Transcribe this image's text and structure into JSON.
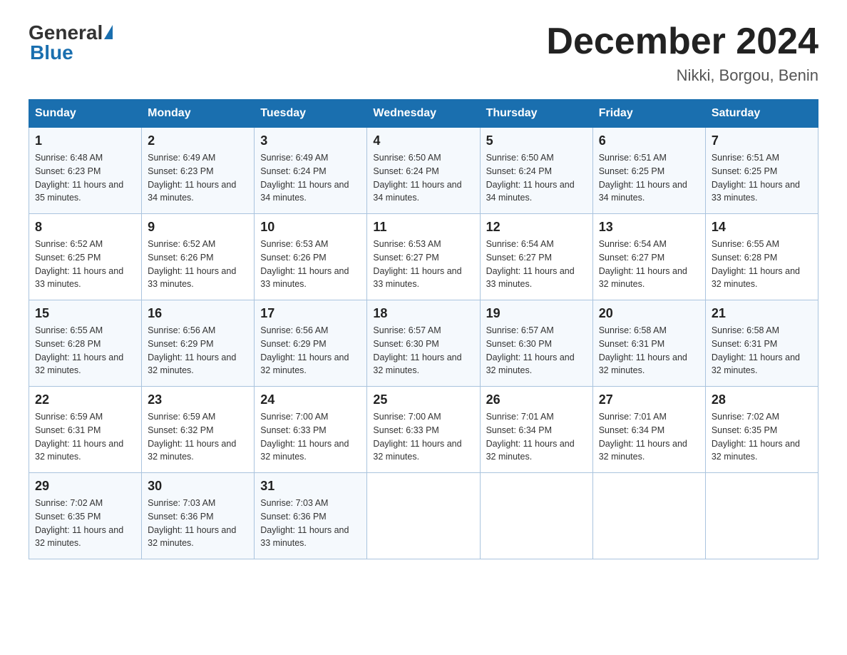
{
  "header": {
    "logo_general": "General",
    "logo_blue": "Blue",
    "month_title": "December 2024",
    "location": "Nikki, Borgou, Benin"
  },
  "weekdays": [
    "Sunday",
    "Monday",
    "Tuesday",
    "Wednesday",
    "Thursday",
    "Friday",
    "Saturday"
  ],
  "weeks": [
    [
      {
        "day": "1",
        "sunrise": "6:48 AM",
        "sunset": "6:23 PM",
        "daylight": "11 hours and 35 minutes."
      },
      {
        "day": "2",
        "sunrise": "6:49 AM",
        "sunset": "6:23 PM",
        "daylight": "11 hours and 34 minutes."
      },
      {
        "day": "3",
        "sunrise": "6:49 AM",
        "sunset": "6:24 PM",
        "daylight": "11 hours and 34 minutes."
      },
      {
        "day": "4",
        "sunrise": "6:50 AM",
        "sunset": "6:24 PM",
        "daylight": "11 hours and 34 minutes."
      },
      {
        "day": "5",
        "sunrise": "6:50 AM",
        "sunset": "6:24 PM",
        "daylight": "11 hours and 34 minutes."
      },
      {
        "day": "6",
        "sunrise": "6:51 AM",
        "sunset": "6:25 PM",
        "daylight": "11 hours and 34 minutes."
      },
      {
        "day": "7",
        "sunrise": "6:51 AM",
        "sunset": "6:25 PM",
        "daylight": "11 hours and 33 minutes."
      }
    ],
    [
      {
        "day": "8",
        "sunrise": "6:52 AM",
        "sunset": "6:25 PM",
        "daylight": "11 hours and 33 minutes."
      },
      {
        "day": "9",
        "sunrise": "6:52 AM",
        "sunset": "6:26 PM",
        "daylight": "11 hours and 33 minutes."
      },
      {
        "day": "10",
        "sunrise": "6:53 AM",
        "sunset": "6:26 PM",
        "daylight": "11 hours and 33 minutes."
      },
      {
        "day": "11",
        "sunrise": "6:53 AM",
        "sunset": "6:27 PM",
        "daylight": "11 hours and 33 minutes."
      },
      {
        "day": "12",
        "sunrise": "6:54 AM",
        "sunset": "6:27 PM",
        "daylight": "11 hours and 33 minutes."
      },
      {
        "day": "13",
        "sunrise": "6:54 AM",
        "sunset": "6:27 PM",
        "daylight": "11 hours and 32 minutes."
      },
      {
        "day": "14",
        "sunrise": "6:55 AM",
        "sunset": "6:28 PM",
        "daylight": "11 hours and 32 minutes."
      }
    ],
    [
      {
        "day": "15",
        "sunrise": "6:55 AM",
        "sunset": "6:28 PM",
        "daylight": "11 hours and 32 minutes."
      },
      {
        "day": "16",
        "sunrise": "6:56 AM",
        "sunset": "6:29 PM",
        "daylight": "11 hours and 32 minutes."
      },
      {
        "day": "17",
        "sunrise": "6:56 AM",
        "sunset": "6:29 PM",
        "daylight": "11 hours and 32 minutes."
      },
      {
        "day": "18",
        "sunrise": "6:57 AM",
        "sunset": "6:30 PM",
        "daylight": "11 hours and 32 minutes."
      },
      {
        "day": "19",
        "sunrise": "6:57 AM",
        "sunset": "6:30 PM",
        "daylight": "11 hours and 32 minutes."
      },
      {
        "day": "20",
        "sunrise": "6:58 AM",
        "sunset": "6:31 PM",
        "daylight": "11 hours and 32 minutes."
      },
      {
        "day": "21",
        "sunrise": "6:58 AM",
        "sunset": "6:31 PM",
        "daylight": "11 hours and 32 minutes."
      }
    ],
    [
      {
        "day": "22",
        "sunrise": "6:59 AM",
        "sunset": "6:31 PM",
        "daylight": "11 hours and 32 minutes."
      },
      {
        "day": "23",
        "sunrise": "6:59 AM",
        "sunset": "6:32 PM",
        "daylight": "11 hours and 32 minutes."
      },
      {
        "day": "24",
        "sunrise": "7:00 AM",
        "sunset": "6:33 PM",
        "daylight": "11 hours and 32 minutes."
      },
      {
        "day": "25",
        "sunrise": "7:00 AM",
        "sunset": "6:33 PM",
        "daylight": "11 hours and 32 minutes."
      },
      {
        "day": "26",
        "sunrise": "7:01 AM",
        "sunset": "6:34 PM",
        "daylight": "11 hours and 32 minutes."
      },
      {
        "day": "27",
        "sunrise": "7:01 AM",
        "sunset": "6:34 PM",
        "daylight": "11 hours and 32 minutes."
      },
      {
        "day": "28",
        "sunrise": "7:02 AM",
        "sunset": "6:35 PM",
        "daylight": "11 hours and 32 minutes."
      }
    ],
    [
      {
        "day": "29",
        "sunrise": "7:02 AM",
        "sunset": "6:35 PM",
        "daylight": "11 hours and 32 minutes."
      },
      {
        "day": "30",
        "sunrise": "7:03 AM",
        "sunset": "6:36 PM",
        "daylight": "11 hours and 32 minutes."
      },
      {
        "day": "31",
        "sunrise": "7:03 AM",
        "sunset": "6:36 PM",
        "daylight": "11 hours and 33 minutes."
      },
      null,
      null,
      null,
      null
    ]
  ]
}
